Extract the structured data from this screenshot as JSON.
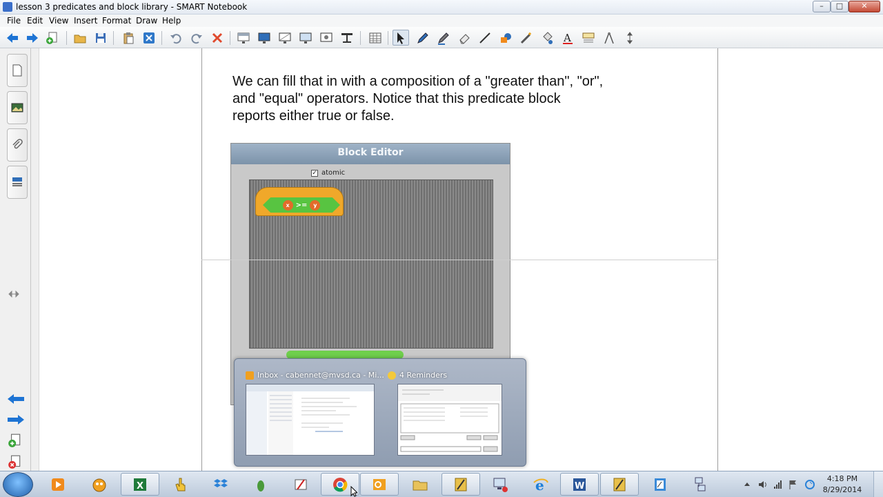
{
  "window": {
    "title": "lesson 3 predicates and block library - SMART Notebook"
  },
  "menu": [
    "File",
    "Edit",
    "View",
    "Insert",
    "Format",
    "Draw",
    "Help"
  ],
  "slide": {
    "text": "We can fill that in with a composition of a \"greater than\", \"or\", and \"equal\" operators. Notice that this predicate block reports either true or false."
  },
  "block_editor": {
    "title": "Block Editor",
    "atomic_label": "atomic",
    "slot_left": "x",
    "operator": ">=",
    "slot_right": "y"
  },
  "taskbar_popup": {
    "item1_title": "Inbox - cabennet@mvsd.ca - Mi...",
    "item2_title": "4 Reminders"
  },
  "clock": {
    "time": "4:18 PM",
    "date": "8/29/2014"
  },
  "colors": {
    "accent": "#1e74d4",
    "block_orange": "#f0a82a",
    "block_green": "#58c441"
  }
}
